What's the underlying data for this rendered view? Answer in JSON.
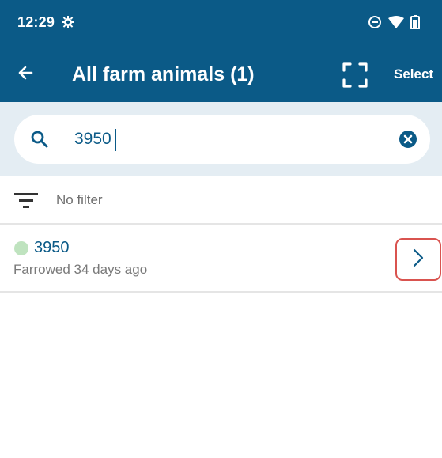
{
  "status_bar": {
    "time": "12:29",
    "icons": [
      "gear-icon",
      "do-not-disturb-icon",
      "wifi-icon",
      "battery-icon"
    ]
  },
  "app_bar": {
    "title": "All farm animals (1)",
    "select_label": "Select",
    "icons": [
      "back-arrow-icon",
      "scan-frame-icon"
    ]
  },
  "search": {
    "value": "3950",
    "icons": [
      "search-icon",
      "clear-icon"
    ]
  },
  "filter": {
    "label": "No filter",
    "icon": "filter-icon"
  },
  "results": [
    {
      "id": "3950",
      "subtitle": "Farrowed 34 days ago",
      "status_color": "#bfe3bf"
    }
  ],
  "colors": {
    "primary": "#0b5a87",
    "search_bg": "#e4edf3",
    "highlight": "#d9534f"
  }
}
